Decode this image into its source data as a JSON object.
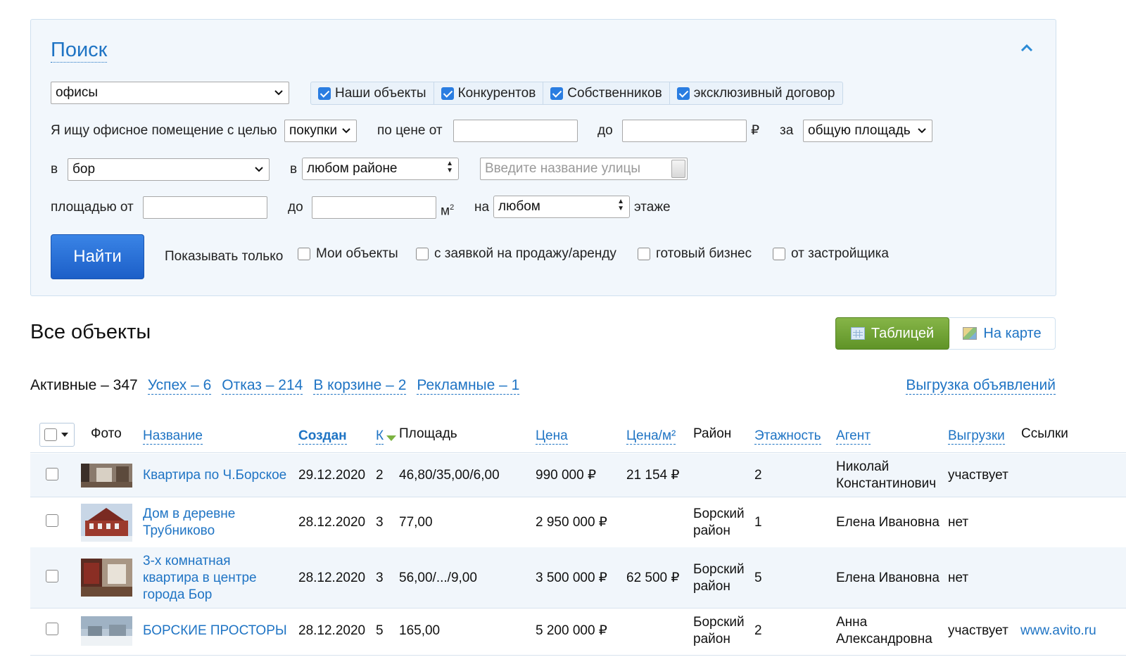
{
  "search": {
    "title": "Поиск",
    "type_select": "офисы",
    "owner_filters": [
      {
        "label": "Наши объекты",
        "checked": true
      },
      {
        "label": "Конкурентов",
        "checked": true
      },
      {
        "label": "Собственников",
        "checked": true
      },
      {
        "label": "эксклюзивный договор",
        "checked": true
      }
    ],
    "purpose_label": "Я ищу офисное помещение с целью",
    "purpose_value": "покупки",
    "price_from_label": "по цене от",
    "price_to_label": "до",
    "currency": "₽",
    "per_label": "за",
    "per_value": "общую площадь",
    "city_label": "в",
    "city_value": "бор",
    "district_label": "в",
    "district_value": "любом районе",
    "street_placeholder": "Введите название улицы",
    "area_from_label": "площадью от",
    "area_to_label": "до",
    "area_unit": "м",
    "area_unit_sup": "2",
    "floor_label": "на",
    "floor_value": "любом",
    "floor_suffix": "этаже",
    "find_button": "Найти",
    "show_only_label": "Показывать только",
    "show_only": [
      {
        "label": "Мои объекты",
        "checked": false
      },
      {
        "label": "с заявкой на продажу/аренду",
        "checked": false
      },
      {
        "label": "готовый бизнес",
        "checked": false
      },
      {
        "label": "от застройщика",
        "checked": false
      }
    ]
  },
  "objects": {
    "title": "Все объекты",
    "view_table": "Таблицей",
    "view_map": "На карте",
    "active": "Активные – 347",
    "filters": [
      "Успех – 6",
      "Отказ – 214",
      "В корзине – 2",
      "Рекламные – 1"
    ],
    "export": "Выгрузка объявлений"
  },
  "table": {
    "headers": {
      "photo": "Фото",
      "name": "Название",
      "created": "Создан",
      "rooms": "К",
      "area": "Площадь",
      "price": "Цена",
      "price_m2": "Цена/м²",
      "district": "Район",
      "floors": "Этажность",
      "agent": "Агент",
      "exports": "Выгрузки",
      "links": "Ссылки"
    },
    "rows": [
      {
        "name": "Квартира по Ч.Борское",
        "created": "29.12.2020",
        "rooms": "2",
        "area": "46,80/35,00/6,00",
        "price": "990 000 ₽",
        "price_m2": "21 154 ₽",
        "district1": "",
        "district2": "",
        "floors": "2",
        "agent1": "Николай",
        "agent2": "Константинович",
        "exports": "участвует",
        "link": ""
      },
      {
        "name1": "Дом в деревне",
        "name2": "Трубниково",
        "created": "28.12.2020",
        "rooms": "3",
        "area": "77,00",
        "price": "2 950 000 ₽",
        "price_m2": "",
        "district1": "Борский",
        "district2": "район",
        "floors": "1",
        "agent": "Елена Ивановна",
        "exports": "нет",
        "link": ""
      },
      {
        "name1": "3-х комнатная",
        "name2": "квартира в центре",
        "name3": "города Бор",
        "created": "28.12.2020",
        "rooms": "3",
        "area": "56,00/.../9,00",
        "price": "3 500 000 ₽",
        "price_m2": "62 500 ₽",
        "district1": "Борский",
        "district2": "район",
        "floors": "5",
        "agent": "Елена Ивановна",
        "exports": "нет",
        "link": ""
      },
      {
        "name": "БОРСКИЕ ПРОСТОРЫ",
        "created": "28.12.2020",
        "rooms": "5",
        "area": "165,00",
        "price": "5 200 000 ₽",
        "price_m2": "",
        "district1": "Борский",
        "district2": "район",
        "floors": "2",
        "agent1": "Анна",
        "agent2": "Александровна",
        "exports": "участвует",
        "link": "www.avito.ru"
      }
    ]
  },
  "colors": {
    "accent": "#1f74c4",
    "find_button": "#2a6fd6",
    "table_button": "#74a534",
    "panel_bg": "#f2f7fc"
  }
}
